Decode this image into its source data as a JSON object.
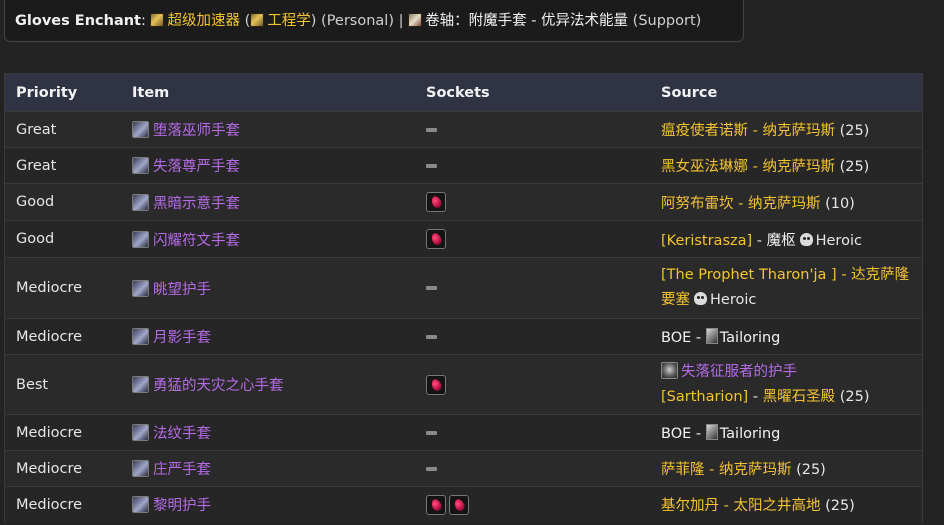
{
  "enchant": {
    "label": "Gloves Enchant",
    "colon": ":",
    "primary_name": "超级加速器",
    "open_paren": "(",
    "primary_prof": "工程学",
    "primary_tag": ") (Personal) |",
    "secondary_name": "卷轴：附魔手套 - 优异法术能量",
    "secondary_tag": "(Support)"
  },
  "table": {
    "headers": {
      "priority": "Priority",
      "item": "Item",
      "sockets": "Sockets",
      "source": "Source"
    },
    "rows": [
      {
        "priority": "Great",
        "item": "堕落巫师手套",
        "sockets": 0,
        "source": {
          "link": "瘟疫使者诺斯 - 纳克萨玛斯",
          "suffix": "(25)"
        }
      },
      {
        "priority": "Great",
        "item": "失落尊严手套",
        "sockets": 0,
        "source": {
          "link": "黑女巫法琳娜 - 纳克萨玛斯",
          "suffix": "(25)"
        }
      },
      {
        "priority": "Good",
        "item": "黑暗示意手套",
        "sockets": 1,
        "source": {
          "link": "阿努布雷坎 - 纳克萨玛斯",
          "suffix": "(10)"
        }
      },
      {
        "priority": "Good",
        "item": "闪耀符文手套",
        "sockets": 1,
        "source": {
          "link": "[Keristrasza]",
          "sep": "-",
          "place": "魔枢",
          "heroic": "Heroic"
        }
      },
      {
        "priority": "Mediocre",
        "item": "眺望护手",
        "sockets": 0,
        "source": {
          "line1": "[The Prophet Tharon'ja ] - 达克萨隆",
          "line2": "要塞",
          "heroic": "Heroic"
        }
      },
      {
        "priority": "Mediocre",
        "item": "月影手套",
        "sockets": 0,
        "source": {
          "boe": "BOE -",
          "profession": "Tailoring"
        }
      },
      {
        "priority": "Best",
        "item": "勇猛的天灾之心手套",
        "sockets": 1,
        "source": {
          "token": "失落征服者的护手",
          "boss": "[Sartharion]",
          "sep": "-",
          "place": "黑曜石圣殿",
          "suffix": "(25)"
        }
      },
      {
        "priority": "Mediocre",
        "item": "法纹手套",
        "sockets": 0,
        "source": {
          "boe": "BOE -",
          "profession": "Tailoring"
        }
      },
      {
        "priority": "Mediocre",
        "item": "庄严手套",
        "sockets": 0,
        "source": {
          "link": "萨菲隆 - 纳克萨玛斯",
          "suffix": "(25)"
        }
      },
      {
        "priority": "Mediocre",
        "item": "黎明护手",
        "sockets": 2,
        "source": {
          "link": "基尔加丹 - 太阳之井高地",
          "suffix": "(25)"
        }
      }
    ]
  },
  "colors": {
    "link_yellow": "#f4c430",
    "item_purple": "#b56be6",
    "header_bg": "#2f3344"
  },
  "icons": {
    "dash": "dash-icon",
    "socket": "red-gem-socket-icon",
    "heroic": "skull-icon",
    "tailoring": "pattern-icon"
  }
}
